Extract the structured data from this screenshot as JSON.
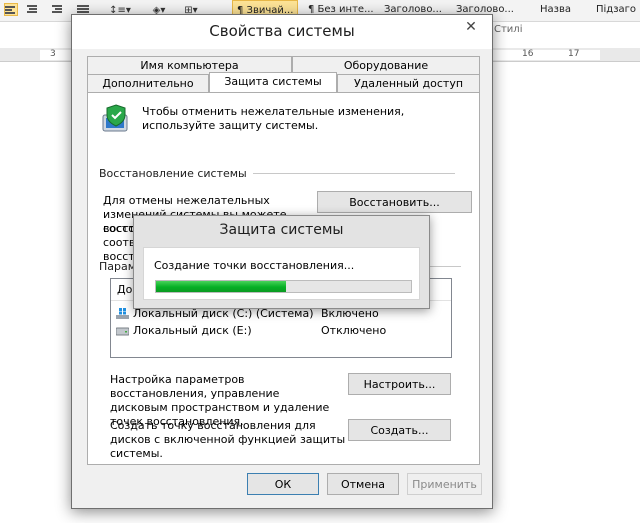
{
  "word": {
    "styles": [
      "¶ Звичай...",
      "¶ Без инте...",
      "Заголово...",
      "Заголово...",
      "Назва",
      "Підзаго"
    ],
    "styles_group_label": "Стилі",
    "ruler_numbers": [
      "3",
      "16",
      "17"
    ]
  },
  "dialog": {
    "title": "Свойства системы",
    "close_label": "✕",
    "tabs_row1": [
      "Имя компьютера",
      "Оборудование"
    ],
    "tabs_row2": [
      "Дополнительно",
      "Защита системы",
      "Удаленный доступ"
    ],
    "active_tab": "Защита системы",
    "intro_text": "Чтобы отменить нежелательные изменения, используйте защиту системы.",
    "restore_section": {
      "title": "Восстановление системы",
      "text": "Для отмены нежелательных изменений системы вы можете восстановить",
      "text_hidden_lines": [
        "состо",
        "соотве",
        "восста"
      ],
      "button": "Восстановить..."
    },
    "params_section": {
      "title": "Параме",
      "list_header_col1": "Дост",
      "list_header_col2": "",
      "rows": [
        {
          "name": "Локальный диск (C:) (Система)",
          "status": "Включено",
          "icon": "windows-drive-icon"
        },
        {
          "name": "Локальный диск (E:)",
          "status": "Отключено",
          "icon": "drive-icon"
        }
      ],
      "configure_text": "Настройка параметров восстановления, управление дисковым пространством и удаление точек восстановления.",
      "configure_button": "Настроить...",
      "create_text": "Создать точку восстановления для дисков с включенной функцией защиты системы.",
      "create_button": "Создать..."
    },
    "footer": {
      "ok": "ОК",
      "cancel": "Отмена",
      "apply": "Применить"
    }
  },
  "progress": {
    "title": "Защита системы",
    "message": "Создание точки восстановления...",
    "percent": 51,
    "color": "#06b025"
  }
}
